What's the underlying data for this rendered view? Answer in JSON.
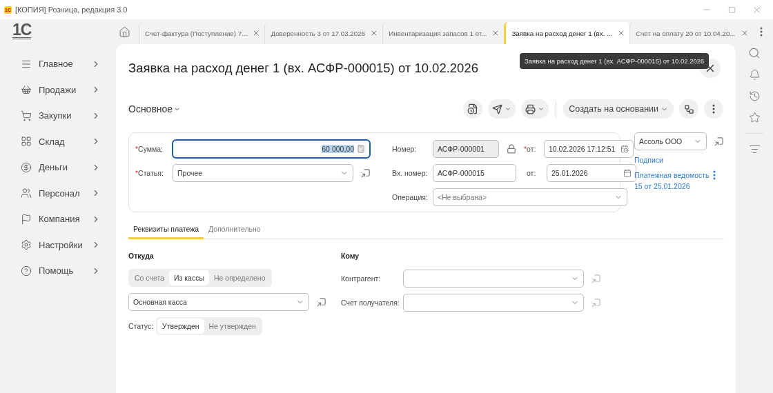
{
  "window": {
    "app_badge": "1С",
    "title": "[КОПИЯ] Розница, редакция 3.0"
  },
  "logo": "1С",
  "sidebar": {
    "items": [
      {
        "label": "Главное"
      },
      {
        "label": "Продажи"
      },
      {
        "label": "Закупки"
      },
      {
        "label": "Склад"
      },
      {
        "label": "Деньги"
      },
      {
        "label": "Персонал"
      },
      {
        "label": "Компания"
      },
      {
        "label": "Настройки"
      },
      {
        "label": "Помощь"
      }
    ]
  },
  "tabs": [
    {
      "label": "Счет-фактура (Поступление) 7...",
      "selected": false
    },
    {
      "label": "Доверенность 3 от 17.03.2026",
      "selected": false
    },
    {
      "label": "Инвентаризация запасов 1 от...",
      "selected": false
    },
    {
      "label": "Заявка на расход денег 1 (вх. ...",
      "selected": true
    },
    {
      "label": "Счет на оплату 20 от 10.04.20...",
      "selected": false
    }
  ],
  "document": {
    "title": "Заявка на расход денег 1 (вх. АСФР-000015) от 10.02.2026",
    "tooltip": "Заявка на расход денег 1 (вх. АСФР-000015) от 10.02.2026",
    "section": "Основное",
    "create_based_on": "Создать на основании"
  },
  "header": {
    "sum": {
      "mark": "*",
      "label": "Сумма:",
      "value": "60 000,00",
      "focused": true
    },
    "article": {
      "mark": "*",
      "label": "Статья:",
      "value": "Прочее"
    },
    "number": {
      "label": "Номер:",
      "value": "АСФР-000001",
      "disabled": true
    },
    "date": {
      "mark": "*",
      "label": "от:",
      "value": "10.02.2026 17:12:51"
    },
    "incoming_number": {
      "label": "Вх. номер:",
      "value": "АСФР-000015"
    },
    "incoming_date": {
      "label": "от:",
      "value": "25.01.2026"
    },
    "operation": {
      "label": "Операция:",
      "placeholder": "<Не выбрана>"
    }
  },
  "side": {
    "organization": "Ассоль ООО",
    "links": [
      "Подписи",
      "Платежная ведомость 15 от 25.01.2026"
    ]
  },
  "form_tabs": [
    {
      "label": "Реквизиты платежа",
      "selected": true
    },
    {
      "label": "Дополнительно",
      "selected": false
    }
  ],
  "from": {
    "heading": "Откуда",
    "source": [
      {
        "label": "Со счета",
        "selected": false
      },
      {
        "label": "Из кассы",
        "selected": true
      },
      {
        "label": "Не определено",
        "selected": false
      }
    ],
    "cashbox": "Основная касса",
    "status_label": "Статус:",
    "status": [
      {
        "label": "Утвержден",
        "selected": true
      },
      {
        "label": "Не утвержден",
        "selected": false
      }
    ]
  },
  "to": {
    "heading": "Кому",
    "fields": [
      {
        "label": "Контрагент:"
      },
      {
        "label": "Счет получателя:"
      }
    ]
  }
}
